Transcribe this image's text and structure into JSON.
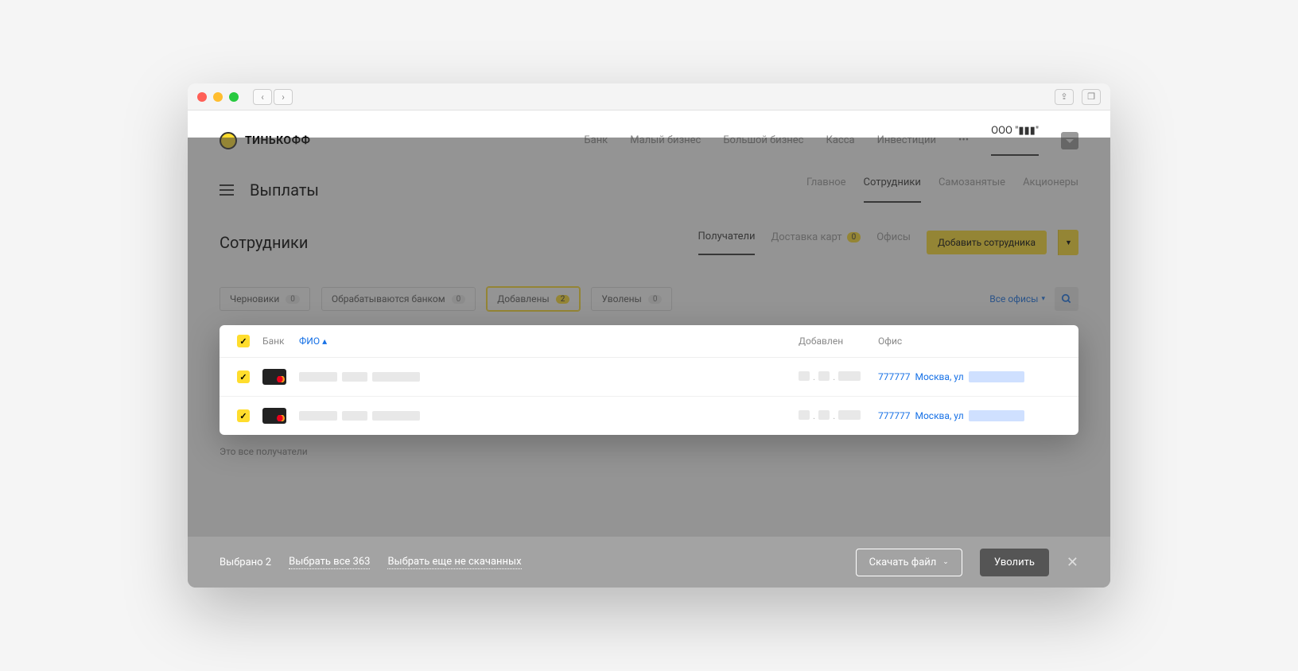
{
  "brand": "ТИНЬКОФФ",
  "company": "ООО \"▮▮▮\"",
  "topnav": {
    "items": [
      "Банк",
      "Малый бизнес",
      "Большой бизнес",
      "Касса",
      "Инвестиции"
    ],
    "more": "•••"
  },
  "page": {
    "title": "Выплаты"
  },
  "subnav": {
    "items": [
      "Главное",
      "Сотрудники",
      "Самозанятые",
      "Акционеры"
    ],
    "active": 1
  },
  "subhead": {
    "title": "Сотрудники"
  },
  "subtabs": {
    "items": [
      {
        "label": "Получатели",
        "active": true
      },
      {
        "label": "Доставка карт",
        "badge": "0"
      },
      {
        "label": "Офисы"
      }
    ],
    "add_label": "Добавить сотрудника"
  },
  "filters": {
    "chips": [
      {
        "label": "Черновики",
        "count": "0"
      },
      {
        "label": "Обрабатываются банком",
        "count": "0"
      },
      {
        "label": "Добавлены",
        "count": "2",
        "active": true
      },
      {
        "label": "Уволены",
        "count": "0"
      }
    ],
    "office_filter": "Все офисы"
  },
  "table": {
    "headers": {
      "bank": "Банк",
      "name": "ФИО",
      "added": "Добавлен",
      "office": "Офис"
    },
    "rows": [
      {
        "office_code": "777777",
        "office_text": "Москва, ул"
      },
      {
        "office_code": "777777",
        "office_text": "Москва, ул"
      }
    ]
  },
  "end_text": "Это все получатели",
  "actionbar": {
    "selected": "Выбрано 2",
    "select_all": "Выбрать все 363",
    "select_more": "Выбрать еще не скачанных",
    "download": "Скачать файл",
    "fire": "Уволить"
  }
}
